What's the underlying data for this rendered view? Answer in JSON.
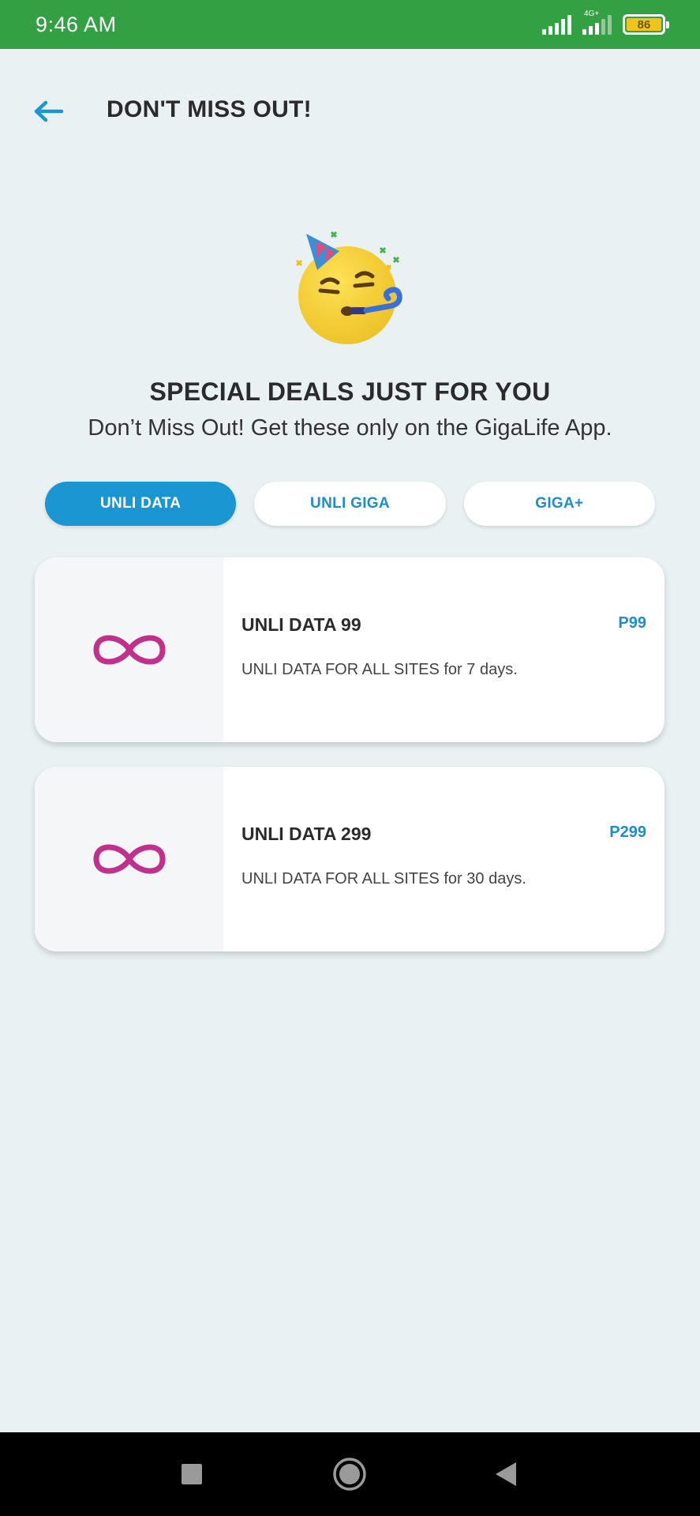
{
  "status_bar": {
    "time": "9:46 AM",
    "network_label": "4G+",
    "battery_level": "86"
  },
  "header": {
    "back_icon": "arrow-left-icon",
    "title": "DON'T MISS OUT!"
  },
  "hero": {
    "icon": "party-face-emoji",
    "headline": "SPECIAL DEALS JUST FOR YOU",
    "subline": "Don’t Miss Out! Get these only on the GigaLife App."
  },
  "tabs": [
    {
      "label": "UNLI DATA",
      "active": true
    },
    {
      "label": "UNLI GIGA",
      "active": false
    },
    {
      "label": "GIGA+",
      "active": false
    }
  ],
  "offers": [
    {
      "icon": "infinity-icon",
      "title": "UNLI DATA 99",
      "price": "P99",
      "description": "UNLI DATA FOR ALL SITES for 7 days."
    },
    {
      "icon": "infinity-icon",
      "title": "UNLI DATA 299",
      "price": "P299",
      "description": "UNLI DATA FOR ALL SITES for 30 days."
    }
  ],
  "colors": {
    "status_bar": "#33a043",
    "accent": "#1a96d3",
    "infinity": "#c2308e",
    "background": "#e9f1f3"
  }
}
